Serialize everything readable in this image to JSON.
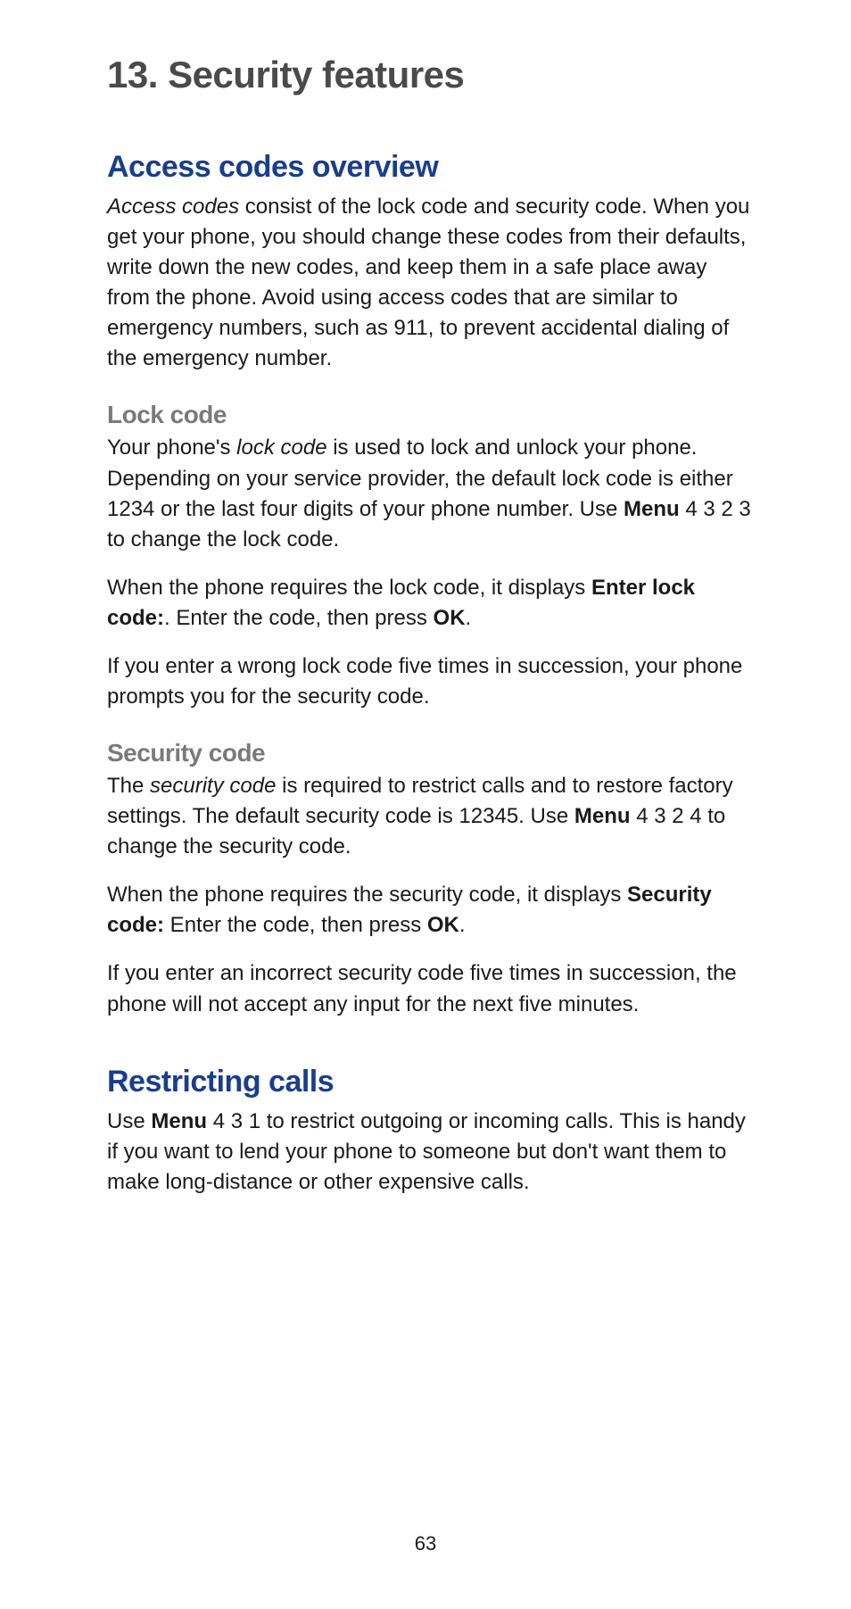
{
  "chapter": {
    "number": "13.",
    "title": "Security features"
  },
  "sections": {
    "access_codes": {
      "title": "Access codes overview",
      "intro_italic": "Access codes",
      "intro_rest": " consist of the lock code and security code. When you get your phone, you should change these codes from their defaults, write down the new codes, and keep them in a safe place away from the phone. Avoid using access codes that are similar to emergency numbers, such as 911, to prevent accidental dialing of the emergency number."
    },
    "lock_code": {
      "title": "Lock code",
      "p1_a": "Your phone's ",
      "p1_italic": "lock code",
      "p1_b": " is used to lock and unlock your phone. Depending on your service provider, the default lock code is either 1234 or the last four digits of your phone number. Use ",
      "p1_bold1": "Menu",
      "p1_c": " 4 3 2 3 to change the lock code.",
      "p2_a": "When the phone requires the lock code, it displays ",
      "p2_bold1": "Enter lock code:",
      "p2_b": ". Enter the code, then press ",
      "p2_bold2": "OK",
      "p2_c": ".",
      "p3": "If you enter a wrong lock code five times in succession, your phone prompts you for the security code."
    },
    "security_code": {
      "title": "Security code",
      "p1_a": "The ",
      "p1_italic": "security code",
      "p1_b": " is required to restrict calls and to restore factory settings. The default security code is 12345. Use ",
      "p1_bold1": "Menu",
      "p1_c": " 4 3 2 4 to change the security code.",
      "p2_a": "When the phone requires the security code, it displays ",
      "p2_bold1": "Security code:",
      "p2_b": "  Enter the code, then press ",
      "p2_bold2": "OK",
      "p2_c": ".",
      "p3": "If you enter an incorrect security code five times in succession, the phone will not accept any input for the next five minutes."
    },
    "restricting_calls": {
      "title": "Restricting calls",
      "p1_a": "Use ",
      "p1_bold1": "Menu",
      "p1_b": " 4 3 1 to restrict outgoing or incoming calls. This is handy if you want to lend your phone to someone but don't want them to make long-distance or other expensive calls."
    }
  },
  "page_number": "63"
}
